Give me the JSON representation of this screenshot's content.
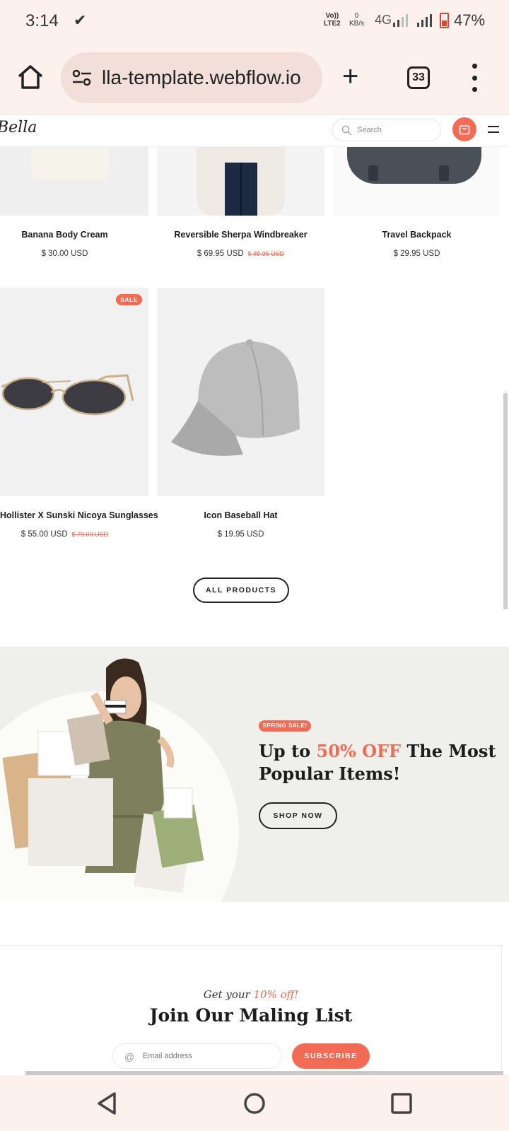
{
  "status_bar": {
    "time": "3:14",
    "check_icon": "task-check-icon",
    "volte_line1": "Vo))",
    "volte_line2": "LTE2",
    "kbs_value": "0",
    "kbs_unit": "KB/s",
    "network": "4G",
    "battery_pct": "47%"
  },
  "browser": {
    "url": "lla-template.webflow.io",
    "tab_count": "33"
  },
  "site": {
    "logo": "Bella",
    "search_placeholder": "Search",
    "accent_color": "#f26b55"
  },
  "products": [
    {
      "name": "Banana Body Cream",
      "price": "$ 30.00 USD",
      "old_price": ""
    },
    {
      "name": "Reversible Sherpa Windbreaker",
      "price": "$ 69.95 USD",
      "old_price": "$ 88.95 USD"
    },
    {
      "name": "Travel Backpack",
      "price": "$ 29.95 USD",
      "old_price": ""
    },
    {
      "name": "Hollister X Sunski Nicoya Sunglasses",
      "price": "$ 55.00 USD",
      "old_price": "$ 79.00 USD",
      "badge": "SALE"
    },
    {
      "name": "Icon Baseball Hat",
      "price": "$ 19.95 USD",
      "old_price": ""
    }
  ],
  "all_products_label": "ALL PRODUCTS",
  "promo": {
    "badge": "SPRING SALE!",
    "title_pre": "Up to ",
    "title_accent": "50% OFF",
    "title_post": " The Most Popular Items!",
    "cta": "SHOP NOW"
  },
  "newsletter": {
    "tag_pre": "Get your ",
    "tag_accent": "10% off!",
    "title": "Join Our Maling List",
    "email_placeholder": "Email address",
    "subscribe": "SUBSCRIBE"
  }
}
